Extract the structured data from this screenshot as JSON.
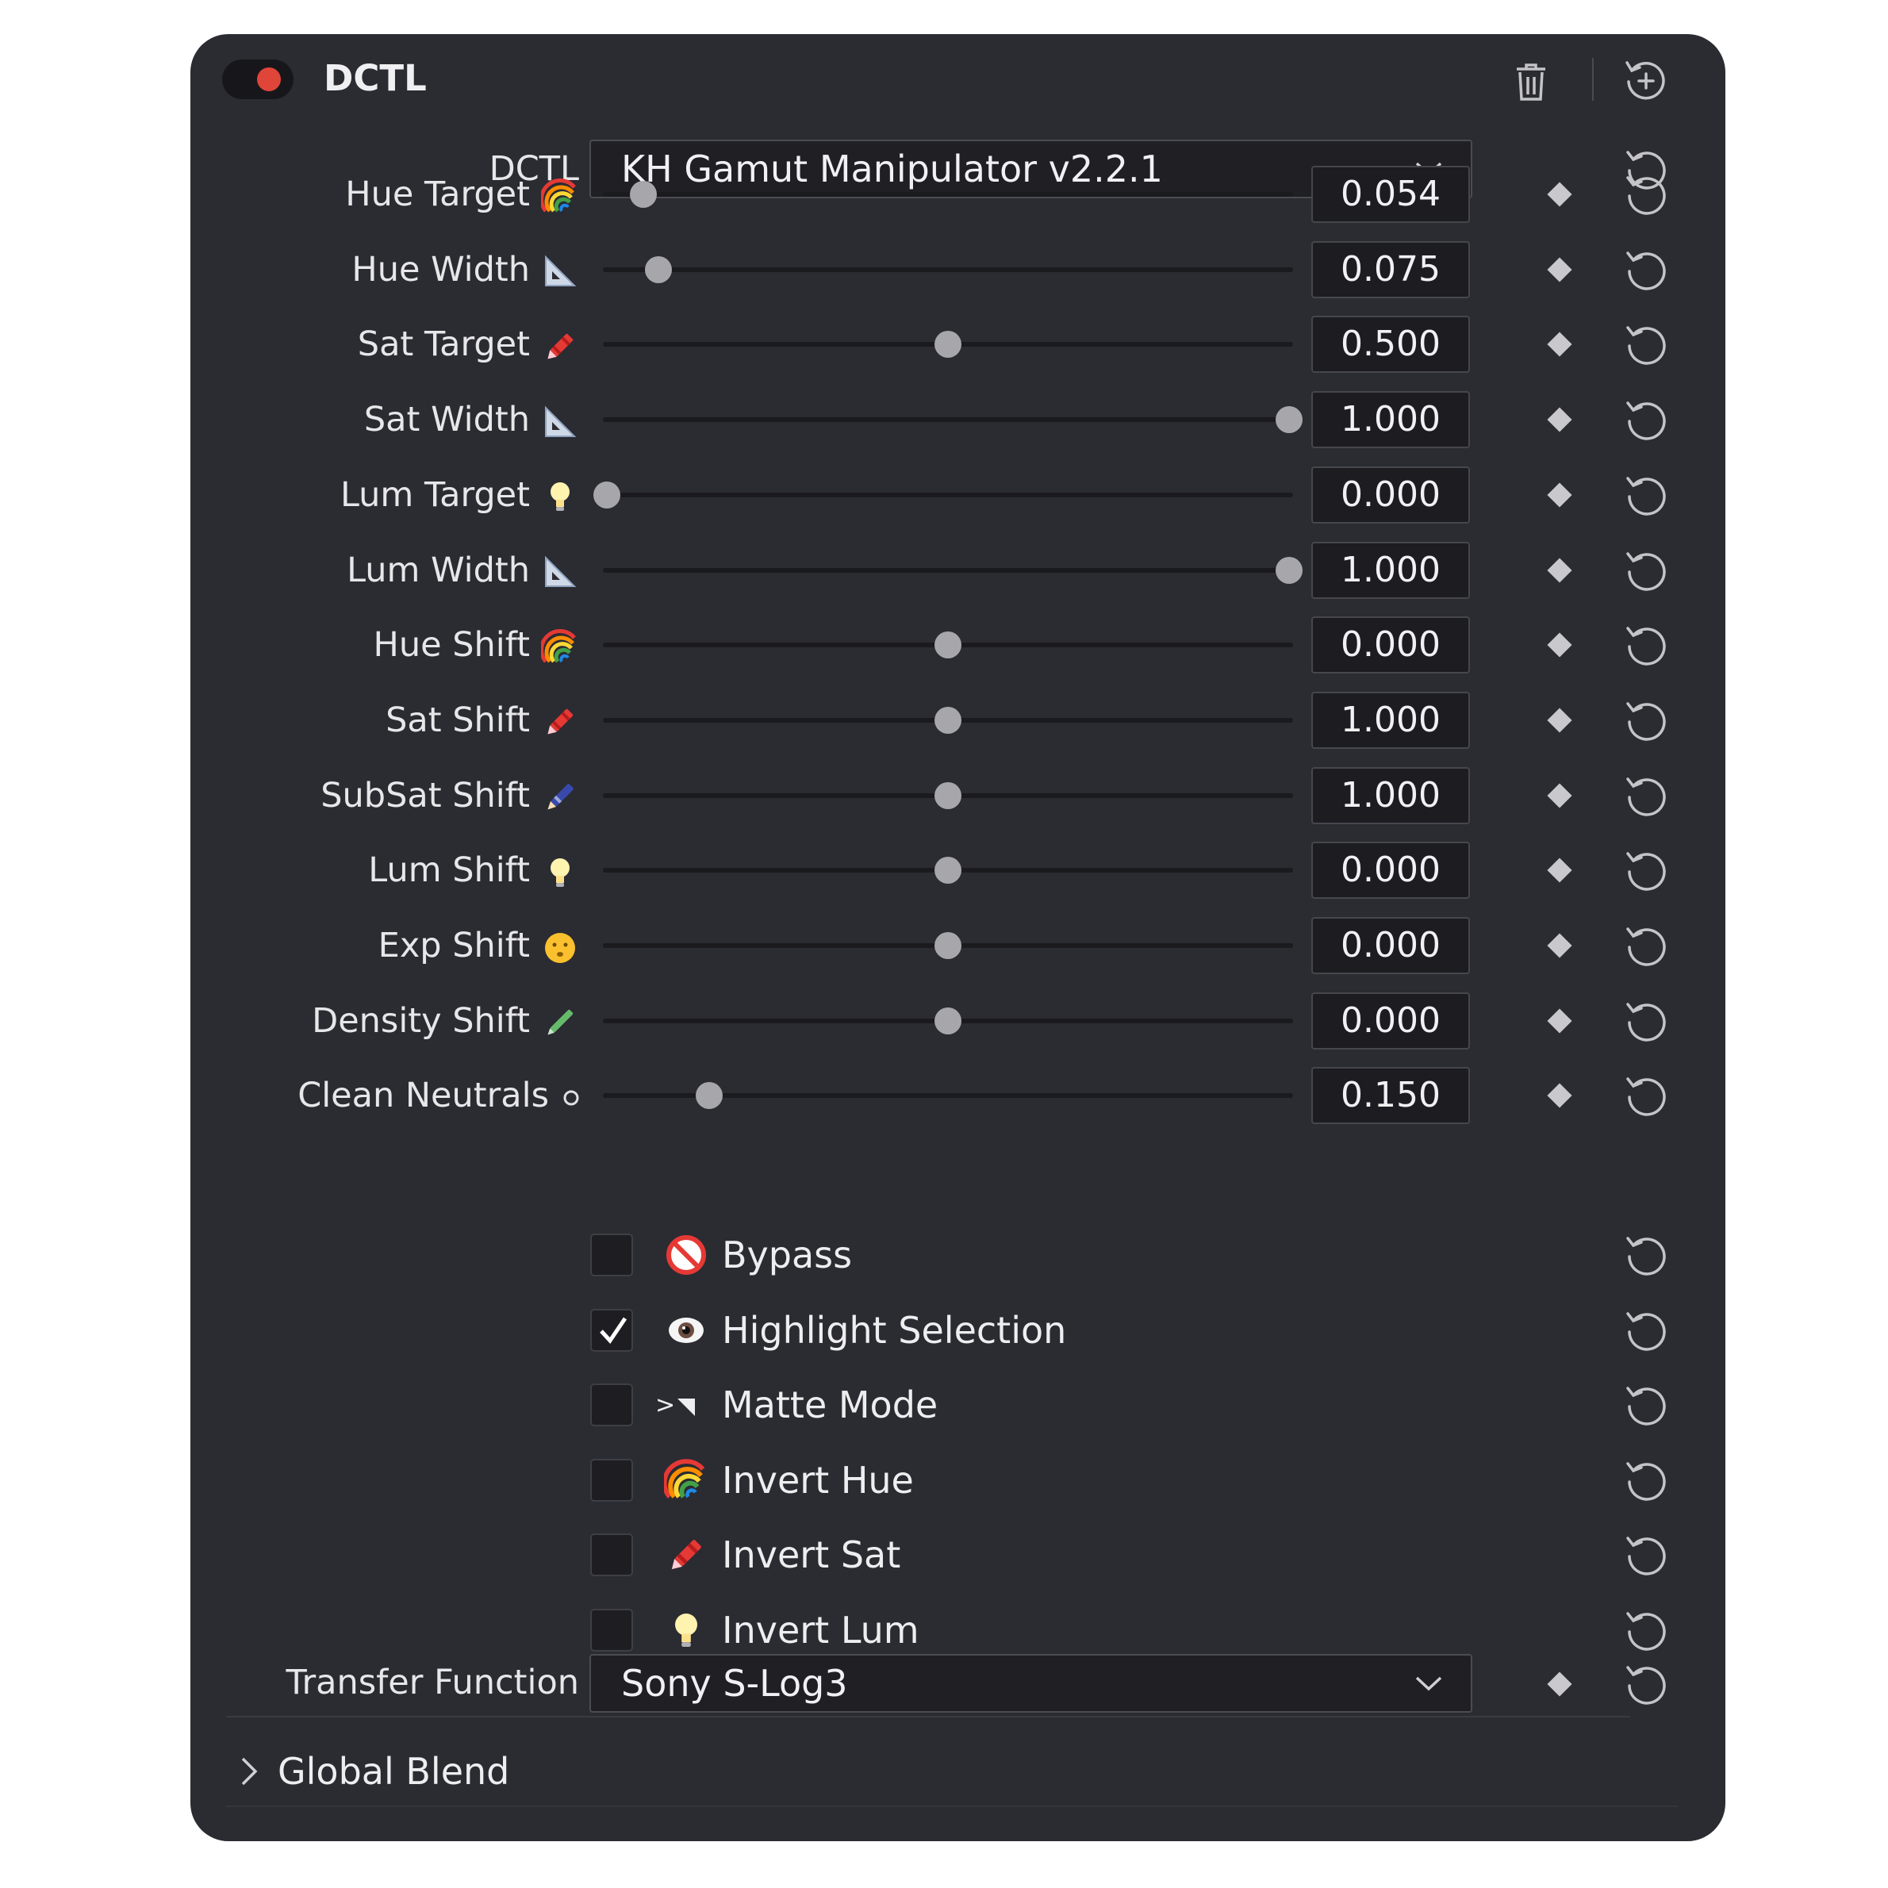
{
  "header": {
    "title": "DCTL",
    "enabled": true,
    "toggle_color": "#e0453a"
  },
  "dctl_select": {
    "label": "DCTL",
    "value": "KH Gamut Manipulator v2.2.1"
  },
  "sliders": [
    {
      "label": "Hue Target",
      "icon": "rainbow-icon",
      "value": "0.054",
      "level": 0.054
    },
    {
      "label": "Hue Width",
      "icon": "triangle-ruler-icon",
      "value": "0.075",
      "level": 0.075
    },
    {
      "label": "Sat Target",
      "icon": "crayon-icon",
      "value": "0.500",
      "level": 0.5
    },
    {
      "label": "Sat Width",
      "icon": "triangle-ruler-icon",
      "value": "1.000",
      "level": 1.0
    },
    {
      "label": "Lum Target",
      "icon": "lightbulb-icon",
      "value": "0.000",
      "level": 0.0
    },
    {
      "label": "Lum Width",
      "icon": "triangle-ruler-icon",
      "value": "1.000",
      "level": 1.0
    },
    {
      "label": "Hue Shift",
      "icon": "rainbow-icon",
      "value": "0.000",
      "level": 0.5
    },
    {
      "label": "Sat Shift",
      "icon": "crayon-icon",
      "value": "1.000",
      "level": 0.5
    },
    {
      "label": "SubSat Shift",
      "icon": "pen-icon",
      "value": "1.000",
      "level": 0.5
    },
    {
      "label": "Lum Shift",
      "icon": "lightbulb-icon",
      "value": "0.000",
      "level": 0.5
    },
    {
      "label": "Exp Shift",
      "icon": "face-icon",
      "value": "0.000",
      "level": 0.5
    },
    {
      "label": "Density Shift",
      "icon": "pencil-icon",
      "value": "0.000",
      "level": 0.5
    },
    {
      "label": "Clean Neutrals",
      "icon": "circle-icon",
      "value": "0.150",
      "level": 0.15
    }
  ],
  "checkboxes": [
    {
      "label": "Bypass",
      "icon": "prohibited-icon",
      "checked": false
    },
    {
      "label": "Highlight Selection",
      "icon": "eye-icon",
      "checked": true
    },
    {
      "label": "Matte Mode",
      "icon": "matte-icon",
      "prefix": ">",
      "checked": false
    },
    {
      "label": "Invert Hue",
      "icon": "rainbow-icon",
      "checked": false
    },
    {
      "label": "Invert Sat",
      "icon": "crayon-icon",
      "checked": false
    },
    {
      "label": "Invert Lum",
      "icon": "lightbulb-icon",
      "checked": false
    }
  ],
  "transfer_select": {
    "label": "Transfer Function",
    "value": "Sony S-Log3"
  },
  "global_blend": {
    "label": "Global Blend"
  },
  "colors": {
    "panel": "#2b2b32",
    "knob": "#a7a7ab",
    "accent_red": "#e0453a"
  }
}
